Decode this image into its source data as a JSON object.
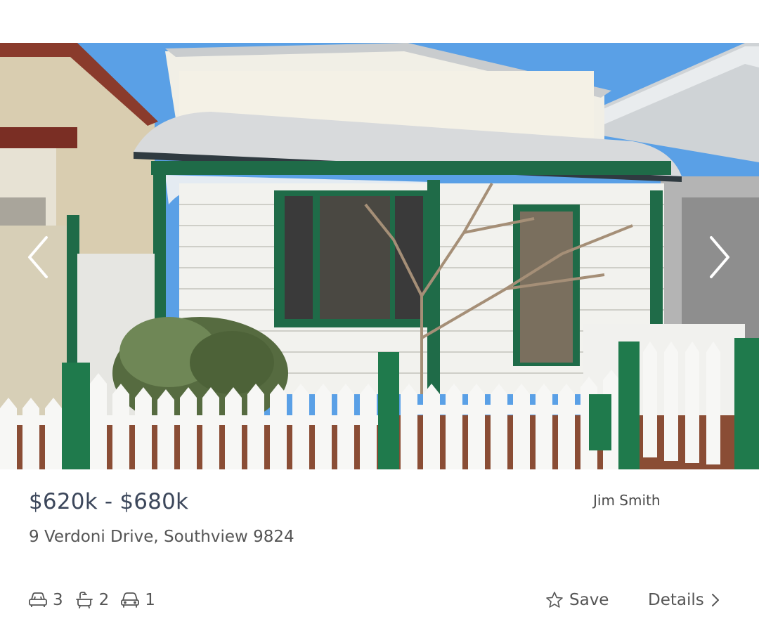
{
  "listing": {
    "price": "$620k - $680k",
    "agent": "Jim Smith",
    "address": "9 Verdoni Drive, Southview 9824"
  },
  "features": {
    "bedrooms": "3",
    "bathrooms": "2",
    "parking": "1"
  },
  "actions": {
    "save_label": "Save",
    "details_label": "Details"
  },
  "icons": {
    "prev": "chevron-left-icon",
    "next": "chevron-right-icon",
    "bed": "bed-icon",
    "bath": "bath-icon",
    "car": "car-icon",
    "save": "star-icon",
    "details": "chevron-right-icon"
  },
  "colors": {
    "trim_green": "#1f6b48",
    "price_text": "#3c475b",
    "body_text": "#555555",
    "sky": "#5aa0e6"
  }
}
